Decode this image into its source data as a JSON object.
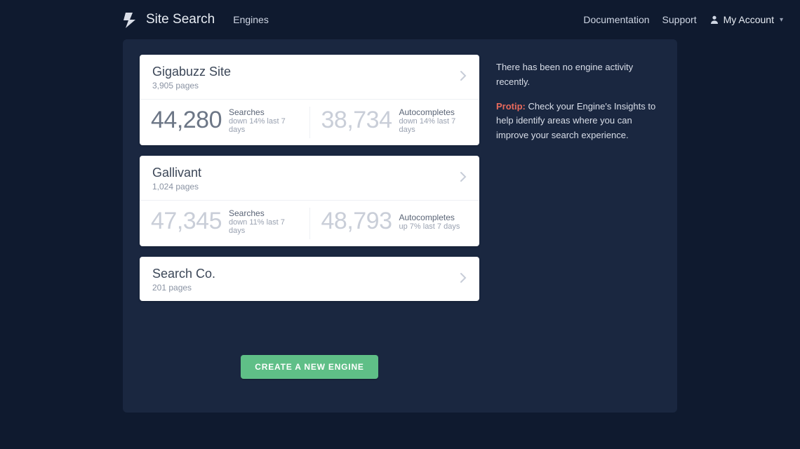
{
  "header": {
    "app_title": "Site Search",
    "nav_engines": "Engines",
    "link_docs": "Documentation",
    "link_support": "Support",
    "account_label": "My Account"
  },
  "sidebar_text": {
    "activity": "There has been no engine activity recently.",
    "protip_label": "Protip:",
    "protip_body": " Check your Engine's Insights to help identify areas where you can improve your search experience."
  },
  "cta_label": "CREATE A NEW ENGINE",
  "engines": [
    {
      "name": "Gigabuzz Site",
      "pages": "3,905 pages",
      "searches_value": "44,280",
      "searches_label": "Searches",
      "searches_delta": "down 14% last 7 days",
      "autos_value": "38,734",
      "autos_label": "Autocompletes",
      "autos_delta": "down 14% last 7 days",
      "has_stats": true,
      "emph_left": true
    },
    {
      "name": "Gallivant",
      "pages": "1,024 pages",
      "searches_value": "47,345",
      "searches_label": "Searches",
      "searches_delta": "down 11% last 7 days",
      "autos_value": "48,793",
      "autos_label": "Autocompletes",
      "autos_delta": "up 7% last 7 days",
      "has_stats": true,
      "emph_left": false
    },
    {
      "name": "Search Co.",
      "pages": "201 pages",
      "has_stats": false
    }
  ]
}
